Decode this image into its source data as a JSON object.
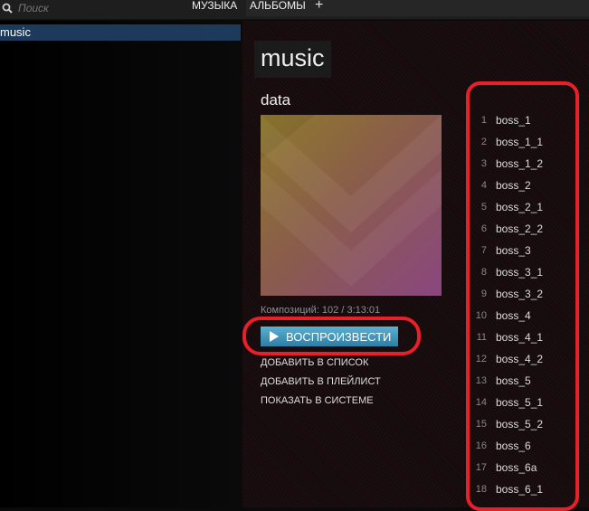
{
  "topbar": {
    "search_placeholder": "Поиск",
    "tabs": [
      {
        "label": "МУЗЫКА"
      },
      {
        "label": "АЛЬБОМЫ"
      }
    ],
    "add_label": "+"
  },
  "sidebar": {
    "items": [
      {
        "label": "music"
      }
    ]
  },
  "album": {
    "title": "music",
    "artist": "data",
    "count": "Композиций: 102 / 3:13:01",
    "play_label": "ВОСПРОИЗВЕСТИ",
    "actions": [
      "ДОБАВИТЬ В СПИСОК",
      "ДОБАВИТЬ В ПЛЕЙЛИСТ",
      "ПОКАЗАТЬ В СИСТЕМЕ"
    ]
  },
  "tracks": [
    {
      "n": "1",
      "t": "boss_1"
    },
    {
      "n": "2",
      "t": "boss_1_1"
    },
    {
      "n": "3",
      "t": "boss_1_2"
    },
    {
      "n": "4",
      "t": "boss_2"
    },
    {
      "n": "5",
      "t": "boss_2_1"
    },
    {
      "n": "6",
      "t": "boss_2_2"
    },
    {
      "n": "7",
      "t": "boss_3"
    },
    {
      "n": "8",
      "t": "boss_3_1"
    },
    {
      "n": "9",
      "t": "boss_3_2"
    },
    {
      "n": "10",
      "t": "boss_4"
    },
    {
      "n": "11",
      "t": "boss_4_1"
    },
    {
      "n": "12",
      "t": "boss_4_2"
    },
    {
      "n": "13",
      "t": "boss_5"
    },
    {
      "n": "14",
      "t": "boss_5_1"
    },
    {
      "n": "15",
      "t": "boss_5_2"
    },
    {
      "n": "16",
      "t": "boss_6"
    },
    {
      "n": "17",
      "t": "boss_6a"
    },
    {
      "n": "18",
      "t": "boss_6_1"
    }
  ],
  "colors": {
    "accent": "#e8202a",
    "play": "#3a93b8",
    "selection": "#1e3a5a"
  }
}
